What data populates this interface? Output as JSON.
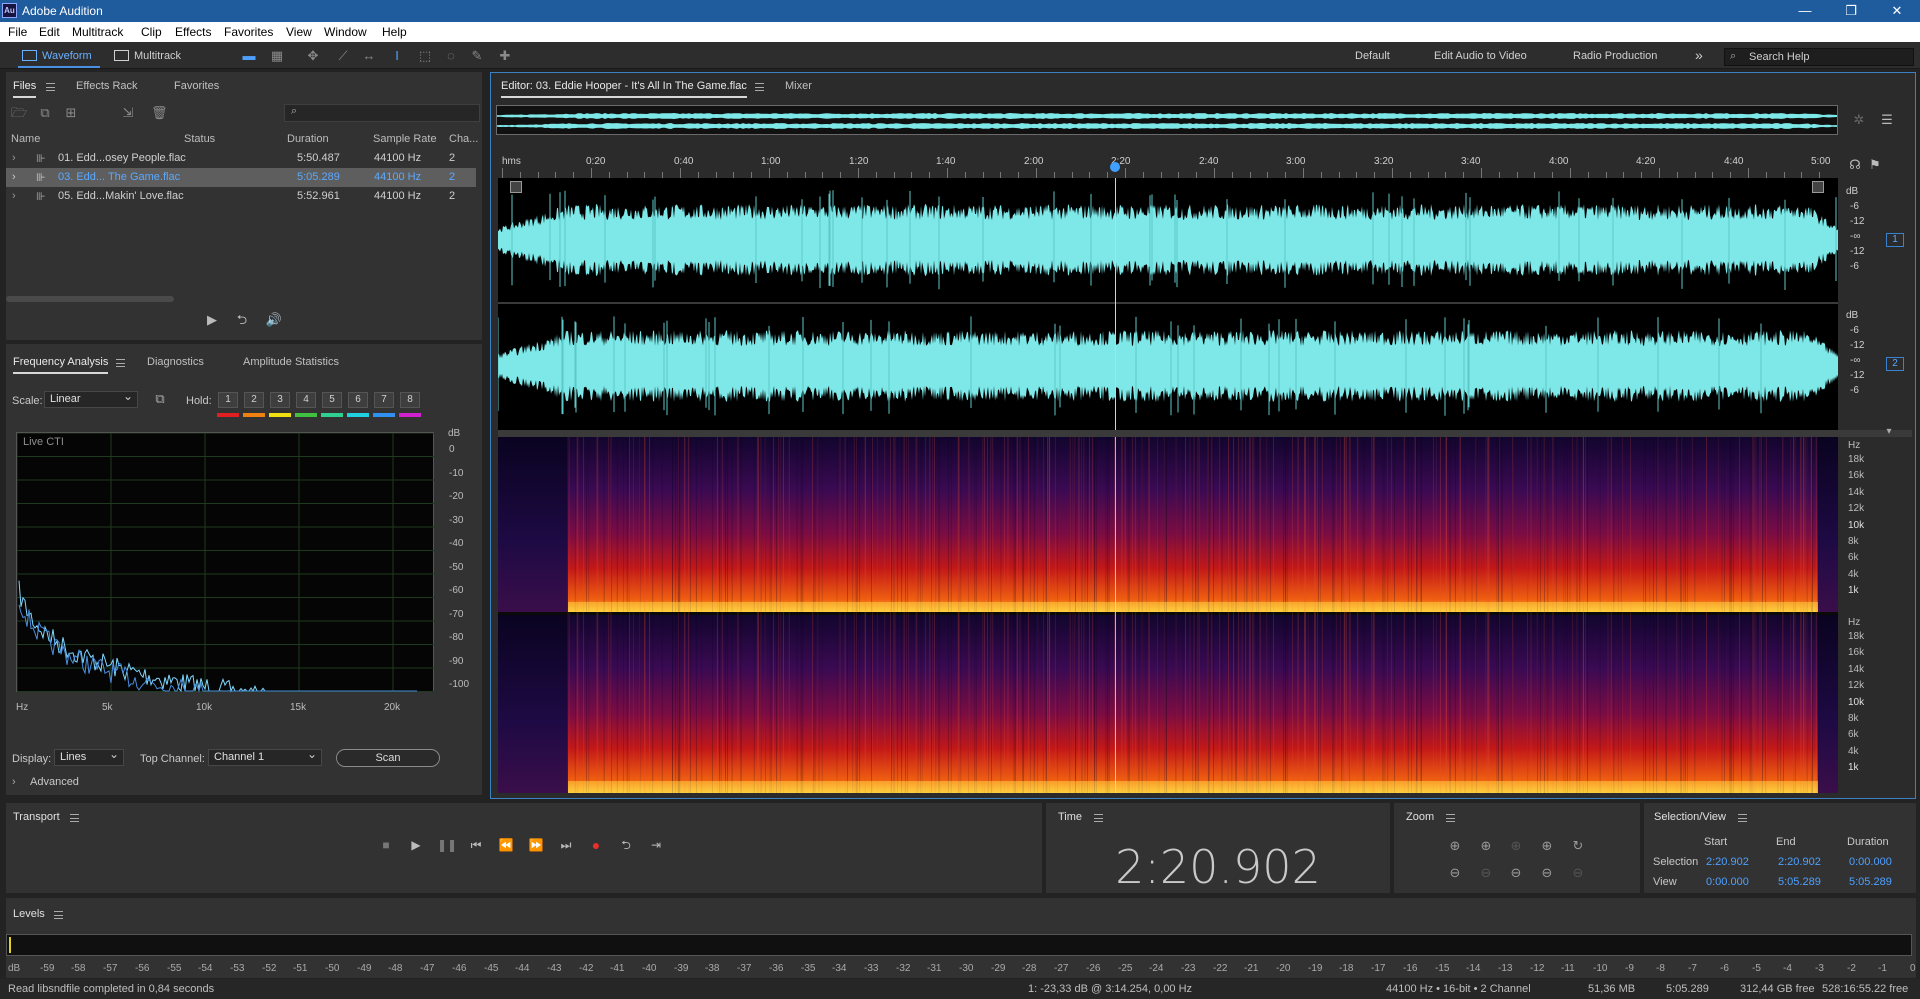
{
  "window": {
    "title": "Adobe Audition",
    "logo": "Au",
    "minimize": "—",
    "restore": "❐",
    "close": "✕"
  },
  "menu": [
    "File",
    "Edit",
    "Multitrack",
    "Clip",
    "Effects",
    "Favorites",
    "View",
    "Window",
    "Help"
  ],
  "toolbar": {
    "waveform_label": "Waveform",
    "multitrack_label": "Multitrack",
    "workspaces": [
      "Default",
      "Edit Audio to Video",
      "Radio Production"
    ],
    "more": "»",
    "search_placeholder": "Search Help"
  },
  "files_panel": {
    "tabs": [
      "Files",
      "Effects Rack",
      "Favorites"
    ],
    "columns": [
      "Name",
      "Status",
      "Duration",
      "Sample Rate",
      "Cha..."
    ],
    "rows": [
      {
        "name": "01. Edd...osey People.flac",
        "duration": "5:50.487",
        "rate": "44100 Hz",
        "ch": "2"
      },
      {
        "name": "03. Edd... The Game.flac",
        "duration": "5:05.289",
        "rate": "44100 Hz",
        "ch": "2"
      },
      {
        "name": "05. Edd...Makin' Love.flac",
        "duration": "5:52.961",
        "rate": "44100 Hz",
        "ch": "2"
      }
    ]
  },
  "frequency_panel": {
    "tabs": [
      "Frequency Analysis",
      "Diagnostics",
      "Amplitude Statistics"
    ],
    "scale_label": "Scale:",
    "scale_value": "Linear",
    "hold_label": "Hold:",
    "hold_buttons": [
      "1",
      "2",
      "3",
      "4",
      "5",
      "6",
      "7",
      "8"
    ],
    "hold_colors": [
      "#e02020",
      "#f08010",
      "#f0e010",
      "#40c040",
      "#30d090",
      "#20d0e0",
      "#3090f0",
      "#d020d0"
    ],
    "graph_title": "Live CTI",
    "db_unit": "dB",
    "db_ticks": [
      "0",
      "-10",
      "-20",
      "-30",
      "-40",
      "-50",
      "-60",
      "-70",
      "-80",
      "-90",
      "-100"
    ],
    "hz_ticks": [
      "Hz",
      "5k",
      "10k",
      "15k",
      "20k"
    ],
    "display_label": "Display:",
    "display_value": "Lines",
    "top_channel_label": "Top Channel:",
    "top_channel_value": "Channel 1",
    "scan_label": "Scan",
    "advanced_label": "Advanced"
  },
  "editor": {
    "tab_label": "Editor: 03. Eddie Hooper - It's All In The Game.flac",
    "mixer_label": "Mixer",
    "ruler": [
      "hms",
      "0:20",
      "0:40",
      "1:00",
      "1:20",
      "1:40",
      "2:00",
      "2:20",
      "2:40",
      "3:00",
      "3:20",
      "3:40",
      "4:00",
      "4:20",
      "4:40",
      "5:00"
    ],
    "db_scale_ch": [
      "dB",
      "-6",
      "-12",
      "-∞",
      "-12",
      "-6"
    ],
    "channels": [
      "1",
      "2"
    ],
    "spectral_top": [
      "Hz",
      "18k",
      "16k",
      "14k",
      "12k",
      "10k",
      "8k",
      "6k",
      "4k",
      "1k"
    ],
    "spectral_bottom": [
      "Hz",
      "18k",
      "16k",
      "14k",
      "12k",
      "10k",
      "8k",
      "6k",
      "4k",
      "1k"
    ],
    "waveform_color": "#7ee8e8"
  },
  "transport": {
    "title": "Transport"
  },
  "time": {
    "title": "Time",
    "value": "2:20.902"
  },
  "zoom": {
    "title": "Zoom"
  },
  "selection_view": {
    "title": "Selection/View",
    "headers": [
      "Start",
      "End",
      "Duration"
    ],
    "selection_label": "Selection",
    "selection": [
      "2:20.902",
      "2:20.902",
      "0:00.000"
    ],
    "view_label": "View",
    "view": [
      "0:00.000",
      "5:05.289",
      "5:05.289"
    ]
  },
  "levels": {
    "title": "Levels",
    "ticks": [
      "dB",
      "-59",
      "-58",
      "-57",
      "-56",
      "-55",
      "-54",
      "-53",
      "-52",
      "-51",
      "-50",
      "-49",
      "-48",
      "-47",
      "-46",
      "-45",
      "-44",
      "-43",
      "-42",
      "-41",
      "-40",
      "-39",
      "-38",
      "-37",
      "-36",
      "-35",
      "-34",
      "-33",
      "-32",
      "-31",
      "-30",
      "-29",
      "-28",
      "-27",
      "-26",
      "-25",
      "-24",
      "-23",
      "-22",
      "-21",
      "-20",
      "-19",
      "-18",
      "-17",
      "-16",
      "-15",
      "-14",
      "-13",
      "-12",
      "-11",
      "-10",
      "-9",
      "-8",
      "-7",
      "-6",
      "-5",
      "-4",
      "-3",
      "-2",
      "-1",
      "0"
    ]
  },
  "status": {
    "message": "Read libsndfile completed in 0,84 seconds",
    "cursor": "1: -23,33 dB @ 3:14.254, 0,00 Hz",
    "format": "44100 Hz • 16-bit • 2 Channel",
    "size": "51,36 MB",
    "duration": "5:05.289",
    "free": "312,44 GB free",
    "free_time": "528:16:55.22 free"
  }
}
